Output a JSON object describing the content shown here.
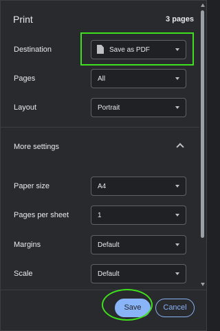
{
  "dialog": {
    "title": "Print",
    "page_count": "3 pages"
  },
  "settings": {
    "destination": {
      "label": "Destination",
      "value": "Save as PDF",
      "icon": "document-icon"
    },
    "pages": {
      "label": "Pages",
      "value": "All"
    },
    "layout": {
      "label": "Layout",
      "value": "Portrait"
    }
  },
  "more_settings": {
    "label": "More settings",
    "expanded": true,
    "paper_size": {
      "label": "Paper size",
      "value": "A4"
    },
    "pages_per_sheet": {
      "label": "Pages per sheet",
      "value": "1"
    },
    "margins": {
      "label": "Margins",
      "value": "Default"
    },
    "scale": {
      "label": "Scale",
      "value": "Default"
    }
  },
  "footer": {
    "save_label": "Save",
    "cancel_label": "Cancel"
  },
  "colors": {
    "background": "#292a2d",
    "accent": "#8ab4f8",
    "annotation": "#3fe11e"
  }
}
